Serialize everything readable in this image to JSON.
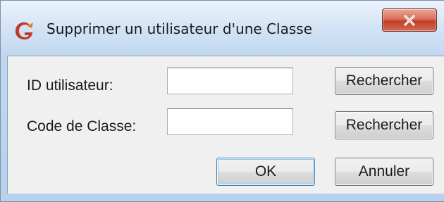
{
  "window": {
    "title": "Supprimer un utilisateur d'une Classe",
    "close_icon": "close-x-icon",
    "app_icon": "app-logo-icon"
  },
  "form": {
    "user_id_label": "ID utilisateur:",
    "user_id_value": "",
    "class_code_label": "Code de Classe:",
    "class_code_value": "",
    "search_user_label": "Rechercher",
    "search_class_label": "Rechercher"
  },
  "actions": {
    "ok_label": "OK",
    "cancel_label": "Annuler"
  },
  "colors": {
    "client_background": "#f0f0f0",
    "close_button": "#c2402a",
    "frame": "#c1d8f1"
  }
}
